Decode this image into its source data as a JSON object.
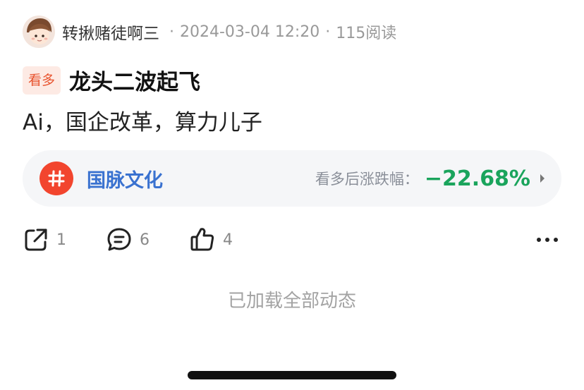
{
  "post": {
    "author": "转揪赌徒啊三",
    "date": "2024-03-04 12:20",
    "views": "115阅读",
    "separator": "·",
    "badge": "看多",
    "title": "龙头二波起飞",
    "body": "Ai，国企改革，算力儿子"
  },
  "stock": {
    "icon": "hash-icon",
    "name": "国脉文化",
    "change_label": "看多后涨跌幅：",
    "change_value": "−22.68%",
    "accent_color": "#3a72d0",
    "change_color": "#1aa45c"
  },
  "actions": {
    "share_count": "1",
    "comment_count": "6",
    "like_count": "4"
  },
  "footer": {
    "loaded_text": "已加载全部动态"
  },
  "colors": {
    "badge_bg": "#fdeae4",
    "badge_text": "#e8542f",
    "hash_bg": "#f2452e"
  }
}
